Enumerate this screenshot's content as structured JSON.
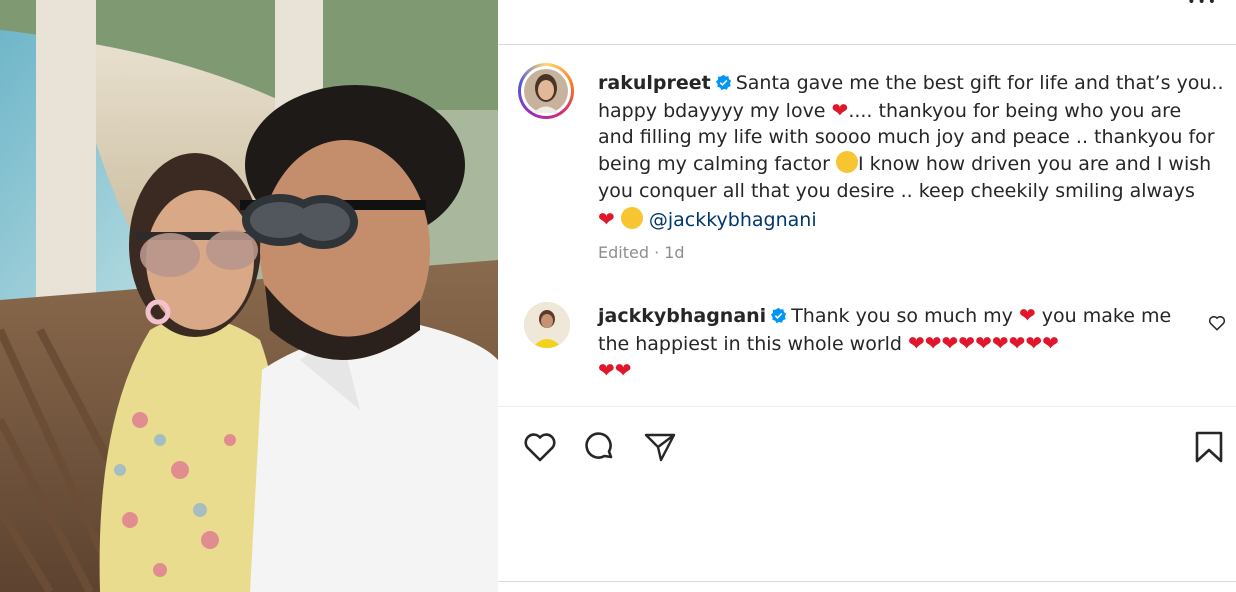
{
  "post": {
    "author": "rakulpreet",
    "caption_line1": "Santa gave me the best gift for life and that’s you..",
    "caption_line2a": "happy bdayyyy my love",
    "caption_line2b": ".... thankyou for being who you are",
    "caption_line3": "and filling my life with soooo much joy and peace .. thankyou for",
    "caption_line4a": "being my calming factor",
    "caption_line4b": "I know how driven you are and I wish",
    "caption_line5": "you conquer all that you desire .. keep cheekily smiling always",
    "caption_mention": "@jackkybhagnani",
    "meta": "Edited · 1d"
  },
  "comment": {
    "author": "jackkybhagnani",
    "text_a": "Thank you so much my",
    "text_b": "you make me",
    "text_line2": "the happiest in this whole world"
  },
  "colors": {
    "heart": "#e0162b",
    "verified": "#0095f6",
    "link": "#00376b",
    "muted": "#8e8e8e"
  },
  "icons": [
    "more-icon",
    "verified-icon",
    "heart-icon",
    "comment-icon",
    "share-icon",
    "bookmark-icon",
    "comment-like-icon"
  ]
}
